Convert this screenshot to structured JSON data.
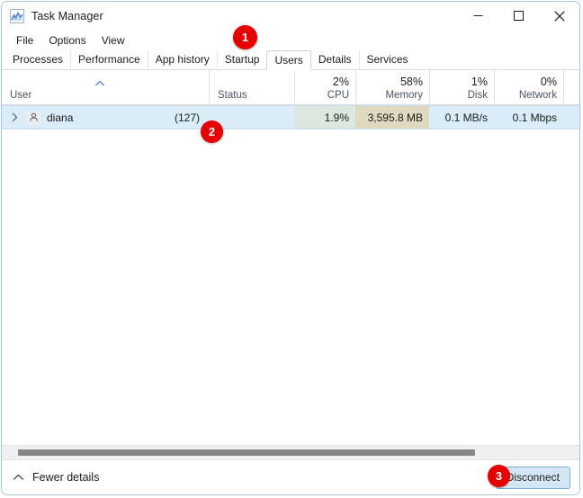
{
  "window": {
    "title": "Task Manager",
    "app_icon": "chart-icon"
  },
  "caption": {
    "minimize": "minimize-icon",
    "maximize": "maximize-icon",
    "close": "close-icon"
  },
  "menu": {
    "items": [
      {
        "label": "File"
      },
      {
        "label": "Options"
      },
      {
        "label": "View"
      }
    ]
  },
  "tabs": {
    "selected": "Users",
    "items": [
      {
        "label": "Processes"
      },
      {
        "label": "Performance"
      },
      {
        "label": "App history"
      },
      {
        "label": "Startup"
      },
      {
        "label": "Users"
      },
      {
        "label": "Details"
      },
      {
        "label": "Services"
      }
    ]
  },
  "columns": [
    {
      "name": "User",
      "pct": "",
      "align": "left"
    },
    {
      "name": "Status",
      "pct": "",
      "align": "left"
    },
    {
      "name": "CPU",
      "pct": "2%",
      "align": "right"
    },
    {
      "name": "Memory",
      "pct": "58%",
      "align": "right"
    },
    {
      "name": "Disk",
      "pct": "1%",
      "align": "right"
    },
    {
      "name": "Network",
      "pct": "0%",
      "align": "right"
    }
  ],
  "sort": {
    "column": "User",
    "direction": "ascending",
    "icon": "sort-ascending-icon"
  },
  "rows": [
    {
      "expander": "chevron-right-icon",
      "avatar": "user-icon",
      "user": "diana",
      "count": "(127)",
      "status": "",
      "cpu": "1.9%",
      "memory": "3,595.8 MB",
      "disk": "0.1 MB/s",
      "network": "0.1 Mbps",
      "selected": true
    }
  ],
  "statusbar": {
    "fewer_details_label": "Fewer details",
    "fewer_details_icon": "chevron-up-icon",
    "disconnect_label": "Disconnect"
  },
  "callouts": [
    {
      "number": "1",
      "target": "tab-users"
    },
    {
      "number": "2",
      "target": "table-row-diana"
    },
    {
      "number": "3",
      "target": "disconnect-button"
    }
  ],
  "colors": {
    "badge": "#e60000",
    "selection": "#d9ecf7",
    "cpu_cell": "#dce7e0",
    "memory_cell": "#ded9bf",
    "button_accent": "#7aaedb",
    "window_border": "#a8c6e0"
  }
}
